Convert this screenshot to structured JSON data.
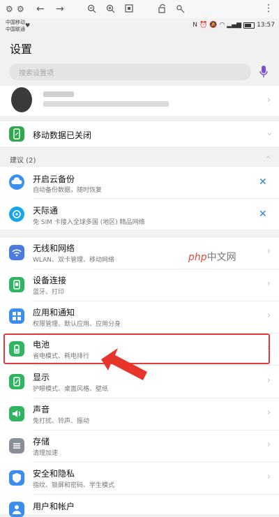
{
  "colors": {
    "accent": "#2a82d6",
    "highlight": "#e03a3a",
    "arrow": "#e8352b"
  },
  "status_bar": {
    "carrier_line1": "中国移动",
    "carrier_line2": "中国联通",
    "time": "13:57"
  },
  "page": {
    "title": "设置"
  },
  "search": {
    "placeholder": "搜索设置项"
  },
  "mobile_data": {
    "title": "移动数据已关闭"
  },
  "suggestions": {
    "label": "建议 (2)",
    "items": [
      {
        "title": "开启云备份",
        "subtitle": "自动备份数据，随时恢复"
      },
      {
        "title": "天际通",
        "subtitle": "免 SIM 卡接入全球多国 (地区) 精品网络"
      }
    ]
  },
  "settings": [
    {
      "title": "无线和网络",
      "subtitle": "WLAN、双卡管理、移动网络"
    },
    {
      "title": "设备连接",
      "subtitle": "蓝牙、打印"
    },
    {
      "title": "应用和通知",
      "subtitle": "权限管理、默认应用、应用分身"
    },
    {
      "title": "电池",
      "subtitle": "省电模式、耗电排行"
    },
    {
      "title": "显示",
      "subtitle": "护眼模式、桌面风格、壁纸"
    },
    {
      "title": "声音",
      "subtitle": "免打扰、铃声、振动"
    },
    {
      "title": "存储",
      "subtitle": "清理加速"
    },
    {
      "title": "安全和隐私",
      "subtitle": "指纹、锁屏和密码、学生模式"
    },
    {
      "title": "用户和帐户",
      "subtitle": ""
    }
  ],
  "watermark": {
    "brand": "php",
    "text": "中文网"
  }
}
